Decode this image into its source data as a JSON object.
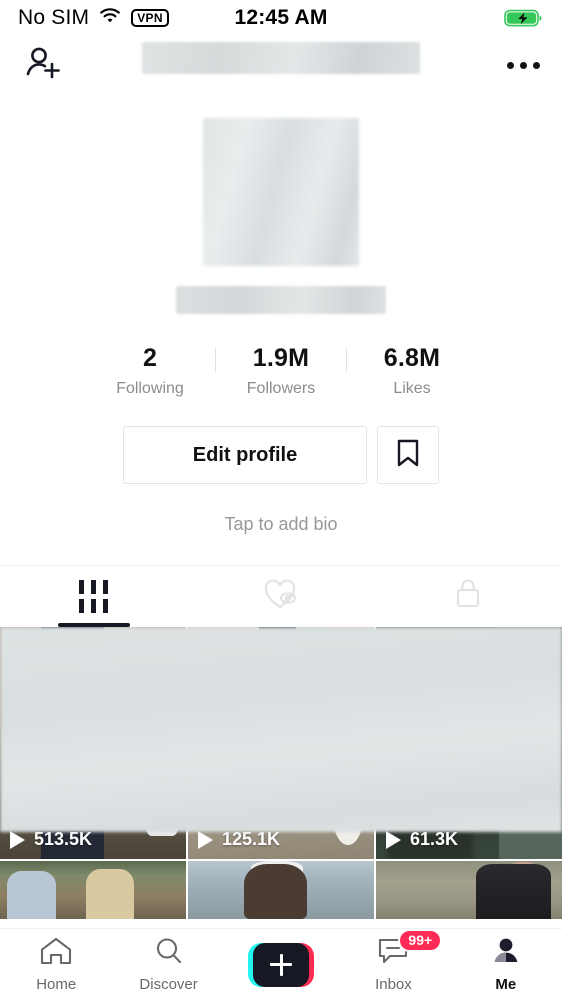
{
  "status_bar": {
    "carrier": "No SIM",
    "wifi_icon": "wifi-icon",
    "vpn_label": "VPN",
    "time": "12:45 AM",
    "battery_icon": "battery-charging-icon",
    "battery_color": "#34c759"
  },
  "header": {
    "add_friend_icon": "add-person-icon",
    "username_redacted": "",
    "more_icon": "more-options-icon",
    "notification_dot_color": "#e8305f"
  },
  "profile": {
    "avatar_redacted": "",
    "username_redacted": "",
    "bio_placeholder": "Tap to add bio",
    "stats": [
      {
        "value": "2",
        "label": "Following"
      },
      {
        "value": "1.9M",
        "label": "Followers"
      },
      {
        "value": "6.8M",
        "label": "Likes"
      }
    ],
    "edit_profile_label": "Edit profile",
    "bookmark_icon": "bookmark-icon"
  },
  "tabs": [
    {
      "name": "videos",
      "icon": "grid-icon",
      "active": true
    },
    {
      "name": "liked",
      "icon": "heart-hidden-icon",
      "active": false
    },
    {
      "name": "private",
      "icon": "lock-icon",
      "active": false
    }
  ],
  "videos": {
    "row1": [
      {
        "views": "513.5K",
        "play_icon": "play-icon"
      },
      {
        "views": "125.1K",
        "play_icon": "play-icon"
      },
      {
        "views": "61.3K",
        "play_icon": "play-icon"
      }
    ]
  },
  "nav": {
    "items": [
      {
        "label": "Home",
        "icon": "home-icon",
        "active": false
      },
      {
        "label": "Discover",
        "icon": "search-icon",
        "active": false
      },
      {
        "label": "",
        "icon": "create-plus-icon",
        "active": false
      },
      {
        "label": "Inbox",
        "icon": "inbox-icon",
        "badge": "99+",
        "active": false
      },
      {
        "label": "Me",
        "icon": "profile-icon",
        "active": true
      }
    ],
    "badge_color": "#fe2c55",
    "create_left_color": "#25f4ee",
    "create_right_color": "#fe2c55"
  }
}
